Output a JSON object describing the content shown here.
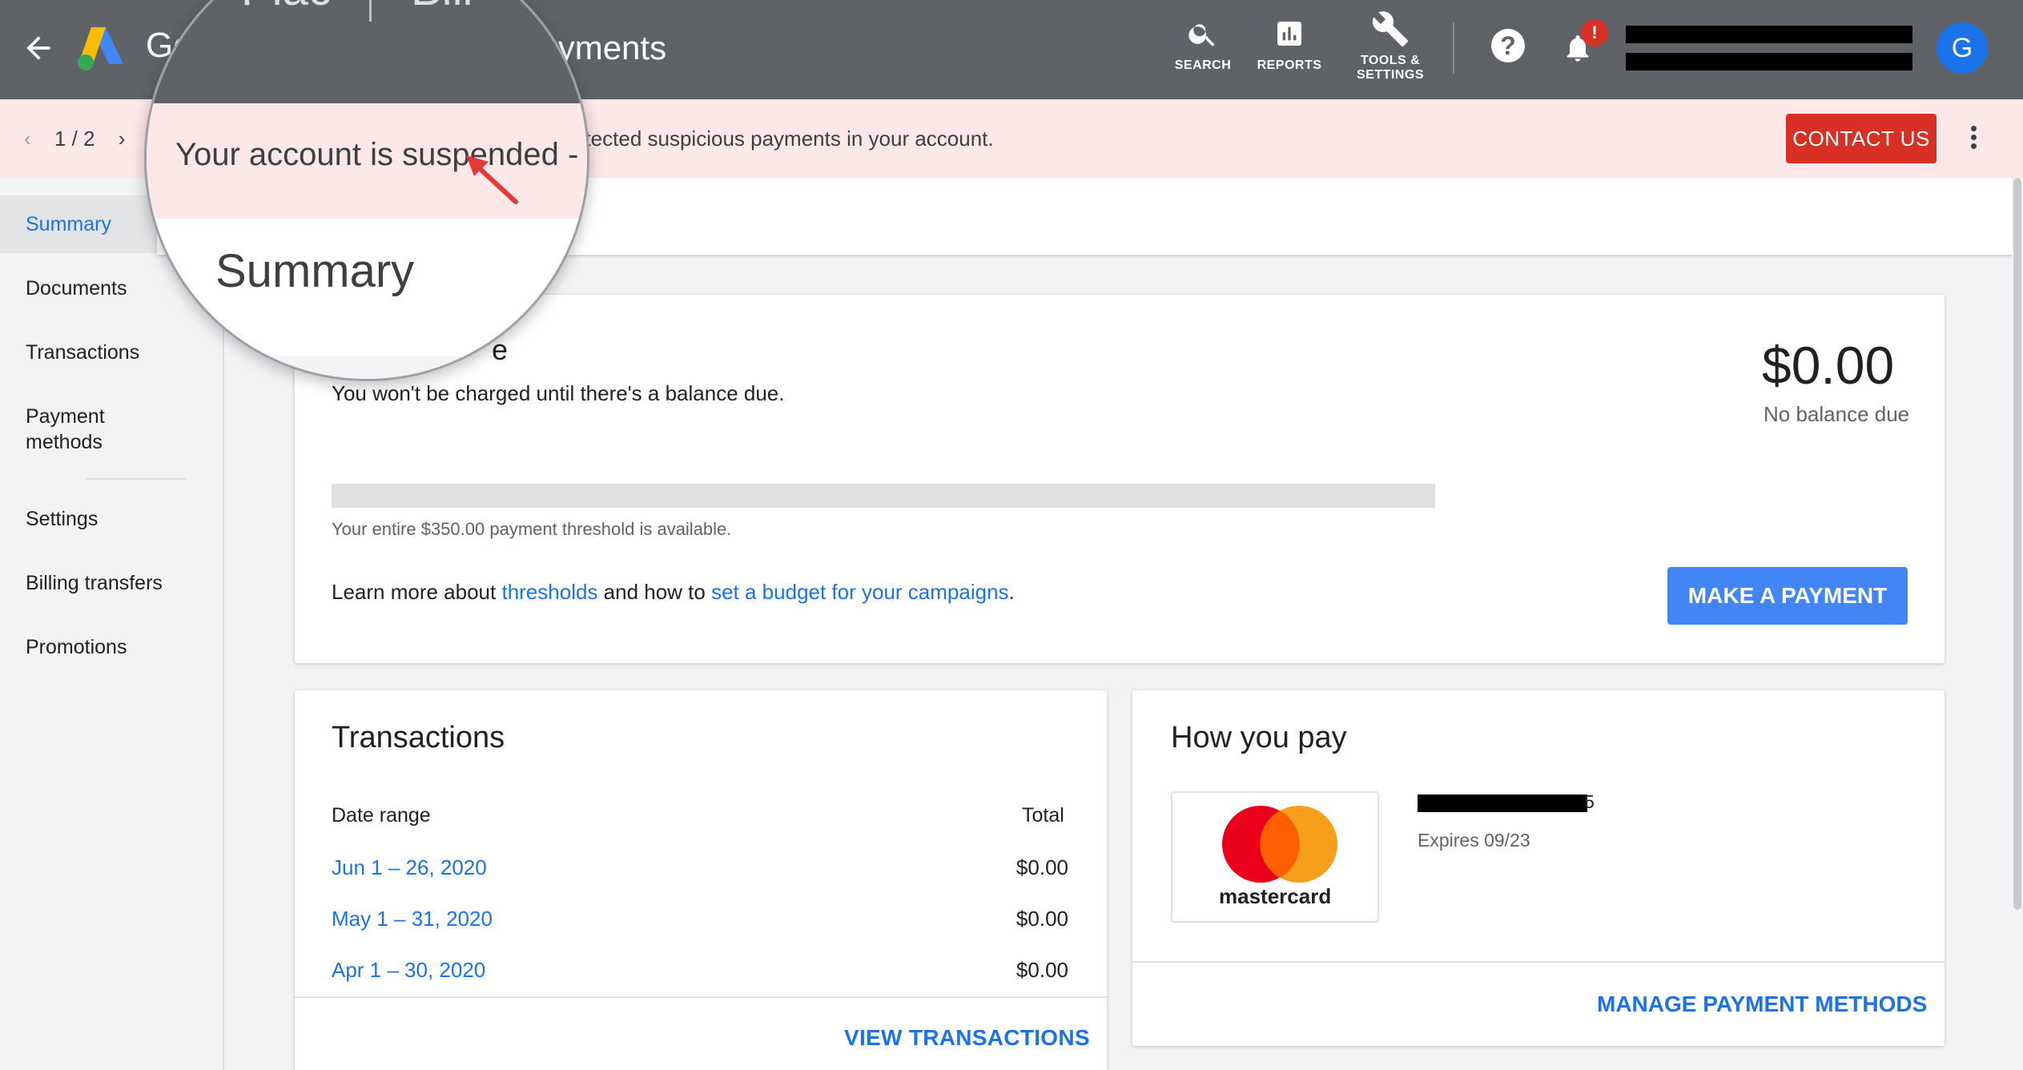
{
  "header": {
    "title_prefix": "Go",
    "title": "payments",
    "icons": [
      {
        "name": "search",
        "label": "SEARCH"
      },
      {
        "name": "reports",
        "label": "REPORTS"
      },
      {
        "name": "tools",
        "label_line1": "TOOLS &",
        "label_line2": "SETTINGS"
      }
    ],
    "help_glyph": "?",
    "bell_badge": "!",
    "avatar_initial": "G"
  },
  "alert": {
    "pager": "1 / 2",
    "message": "etected suspicious payments in your account.",
    "contact_label": "CONTACT US"
  },
  "sidebar": {
    "items": [
      {
        "label": "Summary",
        "active": true
      },
      {
        "label": "Documents"
      },
      {
        "label": "Transactions"
      },
      {
        "label": "Payment methods"
      },
      {
        "label": "Settings"
      },
      {
        "label": "Billing transfers"
      },
      {
        "label": "Promotions"
      }
    ]
  },
  "balance": {
    "title_fragment": "e",
    "subtitle": "You won't be charged until there's a balance due.",
    "amount": "$0.00",
    "amount_label": "No balance due",
    "threshold_text": "Your entire $350.00 payment threshold is available.",
    "learn_prefix": "Learn more about ",
    "thresholds_link": "thresholds",
    "learn_middle": " and how to ",
    "budget_link": "set a budget for your campaigns",
    "learn_suffix": ".",
    "make_payment_label": "MAKE A PAYMENT"
  },
  "transactions": {
    "title": "Transactions",
    "col_date": "Date range",
    "col_total": "Total",
    "rows": [
      {
        "range": "Jun 1 – 26, 2020",
        "total": "$0.00"
      },
      {
        "range": "May 1 – 31, 2020",
        "total": "$0.00"
      },
      {
        "range": "Apr 1 – 30, 2020",
        "total": "$0.00"
      }
    ],
    "view_label": "VIEW TRANSACTIONS"
  },
  "how_you_pay": {
    "title": "How you pay",
    "card_brand": "mastercard",
    "card_number_suffix": "5",
    "expiry": "Expires 09/23",
    "manage_label": "MANAGE PAYMENT METHODS"
  },
  "magnifier": {
    "top_text": "Plac",
    "top_text_right": "Bill",
    "alert_text": "Your account is suspended -",
    "summary_title": "Summary"
  },
  "colors": {
    "topbar": "#5f6368",
    "alert_bg": "#fce8e6",
    "contact_button": "#d93025",
    "primary_button": "#4285f4",
    "link": "#1a73e8",
    "avatar": "#1a73e8"
  }
}
